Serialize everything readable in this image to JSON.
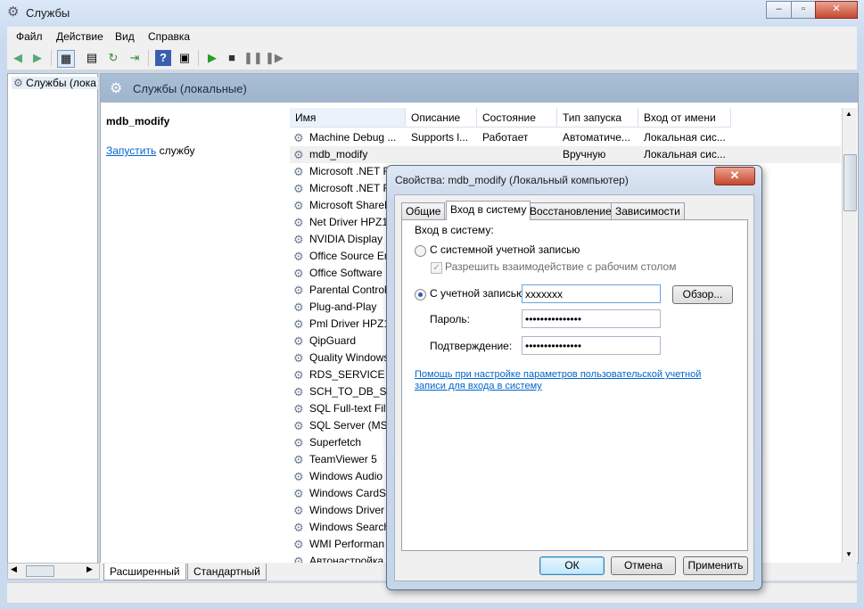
{
  "window": {
    "title": "Службы",
    "minimize": "–",
    "maximize": "▫",
    "close": "✕"
  },
  "menu": [
    "Файл",
    "Действие",
    "Вид",
    "Справка"
  ],
  "tree": {
    "item": "Службы (лока"
  },
  "header": {
    "title": "Службы (локальные)"
  },
  "detail": {
    "service_name": "mdb_modify",
    "start_link": "Запустить",
    "start_suffix": " службу"
  },
  "columns": [
    "Имя",
    "Описание",
    "Состояние",
    "Тип запуска",
    "Вход от имени"
  ],
  "rows": [
    {
      "name": "Machine Debug ...",
      "desc": "Supports l...",
      "state": "Работает",
      "start": "Автоматиче...",
      "logon": "Локальная сис..."
    },
    {
      "name": "mdb_modify",
      "desc": "",
      "state": "",
      "start": "Вручную",
      "logon": "Локальная сис..."
    },
    {
      "name": "Microsoft .NET F",
      "desc": "",
      "state": "",
      "start": "",
      "logon": ""
    },
    {
      "name": "Microsoft .NET F",
      "desc": "",
      "state": "",
      "start": "",
      "logon": ""
    },
    {
      "name": "Microsoft ShareP",
      "desc": "",
      "state": "",
      "start": "",
      "logon": ""
    },
    {
      "name": "Net Driver HPZ12",
      "desc": "",
      "state": "",
      "start": "",
      "logon": ""
    },
    {
      "name": "NVIDIA Display D",
      "desc": "",
      "state": "",
      "start": "",
      "logon": ""
    },
    {
      "name": "Office  Source En",
      "desc": "",
      "state": "",
      "start": "",
      "logon": ""
    },
    {
      "name": "Office Software P",
      "desc": "",
      "state": "",
      "start": "",
      "logon": ""
    },
    {
      "name": "Parental Controls",
      "desc": "",
      "state": "",
      "start": "",
      "logon": ""
    },
    {
      "name": "Plug-and-Play",
      "desc": "",
      "state": "",
      "start": "",
      "logon": ""
    },
    {
      "name": "Pml Driver HPZ12",
      "desc": "",
      "state": "",
      "start": "",
      "logon": ""
    },
    {
      "name": "QipGuard",
      "desc": "",
      "state": "",
      "start": "",
      "logon": ""
    },
    {
      "name": "Quality Windows",
      "desc": "",
      "state": "",
      "start": "",
      "logon": ""
    },
    {
      "name": "RDS_SERVICE",
      "desc": "",
      "state": "",
      "start": "",
      "logon": ""
    },
    {
      "name": "SCH_TO_DB_SER",
      "desc": "",
      "state": "",
      "start": "",
      "logon": ""
    },
    {
      "name": "SQL Full-text Filt",
      "desc": "",
      "state": "",
      "start": "",
      "logon": ""
    },
    {
      "name": "SQL Server (MSS",
      "desc": "",
      "state": "",
      "start": "",
      "logon": ""
    },
    {
      "name": "Superfetch",
      "desc": "",
      "state": "",
      "start": "",
      "logon": ""
    },
    {
      "name": "TeamViewer 5",
      "desc": "",
      "state": "",
      "start": "",
      "logon": ""
    },
    {
      "name": "Windows Audio",
      "desc": "",
      "state": "",
      "start": "",
      "logon": ""
    },
    {
      "name": "Windows CardSp",
      "desc": "",
      "state": "",
      "start": "",
      "logon": ""
    },
    {
      "name": "Windows Driver",
      "desc": "",
      "state": "",
      "start": "",
      "logon": ""
    },
    {
      "name": "Windows Search",
      "desc": "",
      "state": "",
      "start": "",
      "logon": ""
    },
    {
      "name": "WMI Performan",
      "desc": "",
      "state": "",
      "start": "",
      "logon": ""
    },
    {
      "name": "Автонастройка",
      "desc": "",
      "state": "",
      "start": "",
      "logon": ""
    }
  ],
  "bottom_tabs": [
    "Расширенный",
    "Стандартный"
  ],
  "dialog": {
    "title": "Свойства: mdb_modify (Локальный компьютер)",
    "tabs": [
      "Общие",
      "Вход в систему",
      "Восстановление",
      "Зависимости"
    ],
    "section_label": "Вход в систему:",
    "radio_system": "С системной учетной записью",
    "checkbox_desktop": "Разрешить взаимодействие с рабочим столом",
    "radio_account": "С учетной записью:",
    "account_value": "xxxxxxx",
    "browse": "Обзор...",
    "password_label": "Пароль:",
    "password_value": "•••••••••••••••",
    "confirm_label": "Подтверждение:",
    "confirm_value": "•••••••••••••••",
    "help_link": "Помощь при настройке параметров пользовательской учетной записи для входа в систему",
    "ok": "ОК",
    "cancel": "Отмена",
    "apply": "Применить"
  }
}
